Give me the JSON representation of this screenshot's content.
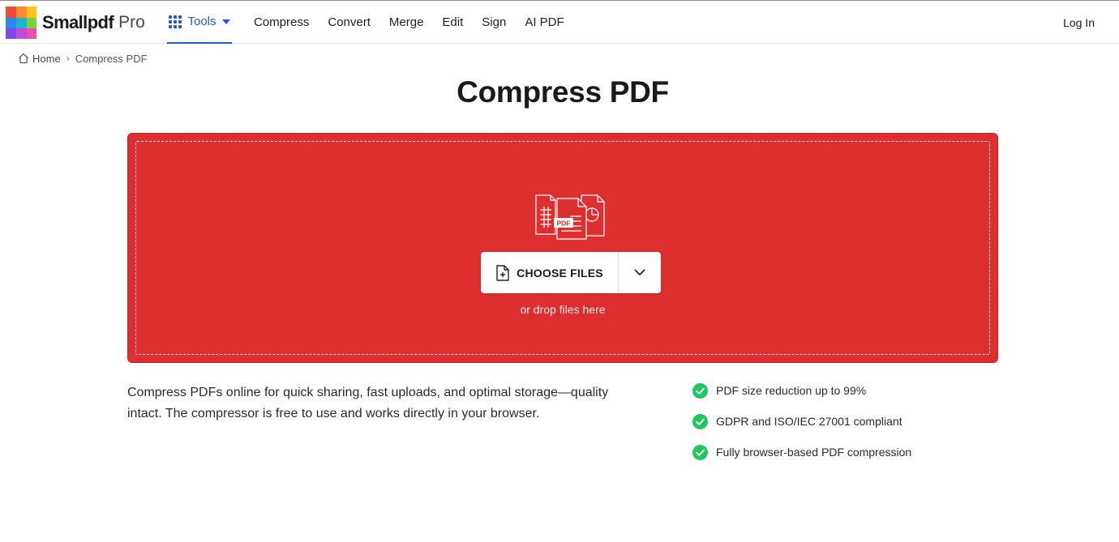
{
  "header": {
    "brand": "Smallpdf",
    "brand_tier": "Pro",
    "tools_label": "Tools",
    "nav": [
      "Compress",
      "Convert",
      "Merge",
      "Edit",
      "Sign",
      "AI PDF"
    ],
    "login_label": "Log In"
  },
  "breadcrumb": {
    "home": "Home",
    "separator": "›",
    "current": "Compress PDF"
  },
  "page": {
    "title": "Compress PDF"
  },
  "dropzone": {
    "illustration_badge": "PDF",
    "choose_label": "CHOOSE FILES",
    "drop_hint": "or drop files here"
  },
  "description": "Compress PDFs online for quick sharing, fast uploads, and optimal storage—quality intact. The compressor is free to use and works directly in your browser.",
  "features": [
    "PDF size reduction up to 99%",
    "GDPR and ISO/IEC 27001 compliant",
    "Fully browser-based PDF compression"
  ],
  "colors": {
    "accent": "#1f5bd4",
    "dropzone": "#dd2f2f",
    "check": "#22c55e"
  },
  "icons": {
    "tools": "grid-icon",
    "home": "home-icon",
    "choose": "file-plus-icon",
    "toggle": "chevron-down-icon",
    "feature": "check-circle-icon"
  }
}
